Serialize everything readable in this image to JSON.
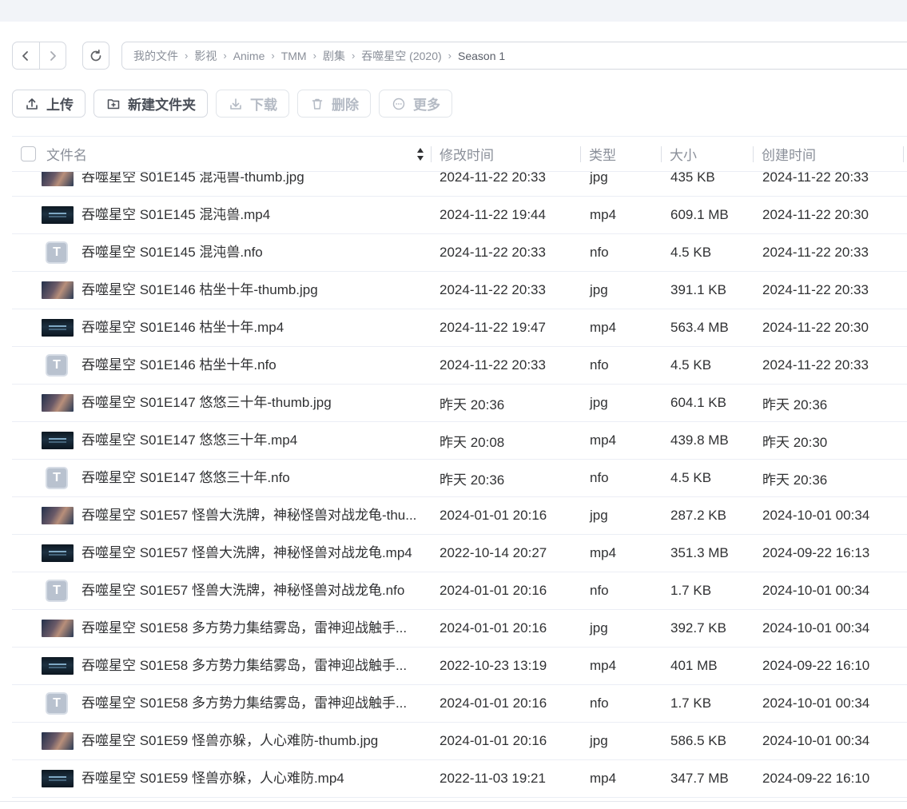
{
  "nav": {
    "breadcrumb": [
      "我的文件",
      "影视",
      "Anime",
      "TMM",
      "剧集",
      "吞噬星空 (2020)",
      "Season 1"
    ],
    "separator": "›"
  },
  "toolbar": {
    "upload": "上传",
    "new_folder": "新建文件夹",
    "download": "下载",
    "delete": "删除",
    "more": "更多"
  },
  "table": {
    "headers": {
      "name": "文件名",
      "mtime": "修改时间",
      "type": "类型",
      "size": "大小",
      "ctime": "创建时间"
    },
    "rows": [
      {
        "name": "吞噬星空 S01E145 混沌兽-thumb.jpg",
        "mtime": "2024-11-22 20:33",
        "type": "jpg",
        "size": "435 KB",
        "ctime": "2024-11-22 20:33",
        "icon": "image"
      },
      {
        "name": "吞噬星空 S01E145 混沌兽.mp4",
        "mtime": "2024-11-22 19:44",
        "type": "mp4",
        "size": "609.1 MB",
        "ctime": "2024-11-22 20:30",
        "icon": "video"
      },
      {
        "name": "吞噬星空 S01E145 混沌兽.nfo",
        "mtime": "2024-11-22 20:33",
        "type": "nfo",
        "size": "4.5 KB",
        "ctime": "2024-11-22 20:33",
        "icon": "nfo"
      },
      {
        "name": "吞噬星空 S01E146 枯坐十年-thumb.jpg",
        "mtime": "2024-11-22 20:33",
        "type": "jpg",
        "size": "391.1 KB",
        "ctime": "2024-11-22 20:33",
        "icon": "image"
      },
      {
        "name": "吞噬星空 S01E146 枯坐十年.mp4",
        "mtime": "2024-11-22 19:47",
        "type": "mp4",
        "size": "563.4 MB",
        "ctime": "2024-11-22 20:30",
        "icon": "video"
      },
      {
        "name": "吞噬星空 S01E146 枯坐十年.nfo",
        "mtime": "2024-11-22 20:33",
        "type": "nfo",
        "size": "4.5 KB",
        "ctime": "2024-11-22 20:33",
        "icon": "nfo"
      },
      {
        "name": "吞噬星空 S01E147 悠悠三十年-thumb.jpg",
        "mtime": "昨天 20:36",
        "type": "jpg",
        "size": "604.1 KB",
        "ctime": "昨天 20:36",
        "icon": "image"
      },
      {
        "name": "吞噬星空 S01E147 悠悠三十年.mp4",
        "mtime": "昨天 20:08",
        "type": "mp4",
        "size": "439.8 MB",
        "ctime": "昨天 20:30",
        "icon": "video"
      },
      {
        "name": "吞噬星空 S01E147 悠悠三十年.nfo",
        "mtime": "昨天 20:36",
        "type": "nfo",
        "size": "4.5 KB",
        "ctime": "昨天 20:36",
        "icon": "nfo"
      },
      {
        "name": "吞噬星空 S01E57 怪兽大洗牌，神秘怪兽对战龙龟-thu...",
        "mtime": "2024-01-01 20:16",
        "type": "jpg",
        "size": "287.2 KB",
        "ctime": "2024-10-01 00:34",
        "icon": "image"
      },
      {
        "name": "吞噬星空 S01E57 怪兽大洗牌，神秘怪兽对战龙龟.mp4",
        "mtime": "2022-10-14 20:27",
        "type": "mp4",
        "size": "351.3 MB",
        "ctime": "2024-09-22 16:13",
        "icon": "video"
      },
      {
        "name": "吞噬星空 S01E57 怪兽大洗牌，神秘怪兽对战龙龟.nfo",
        "mtime": "2024-01-01 20:16",
        "type": "nfo",
        "size": "1.7 KB",
        "ctime": "2024-10-01 00:34",
        "icon": "nfo"
      },
      {
        "name": "吞噬星空 S01E58 多方势力集结雾岛，雷神迎战触手...",
        "mtime": "2024-01-01 20:16",
        "type": "jpg",
        "size": "392.7 KB",
        "ctime": "2024-10-01 00:34",
        "icon": "image"
      },
      {
        "name": "吞噬星空 S01E58 多方势力集结雾岛，雷神迎战触手...",
        "mtime": "2022-10-23 13:19",
        "type": "mp4",
        "size": "401 MB",
        "ctime": "2024-09-22 16:10",
        "icon": "video"
      },
      {
        "name": "吞噬星空 S01E58 多方势力集结雾岛，雷神迎战触手...",
        "mtime": "2024-01-01 20:16",
        "type": "nfo",
        "size": "1.7 KB",
        "ctime": "2024-10-01 00:34",
        "icon": "nfo"
      },
      {
        "name": "吞噬星空 S01E59 怪兽亦躲，人心难防-thumb.jpg",
        "mtime": "2024-01-01 20:16",
        "type": "jpg",
        "size": "586.5 KB",
        "ctime": "2024-10-01 00:34",
        "icon": "image"
      },
      {
        "name": "吞噬星空 S01E59 怪兽亦躲，人心难防.mp4",
        "mtime": "2022-11-03 19:21",
        "type": "mp4",
        "size": "347.7 MB",
        "ctime": "2024-09-22 16:10",
        "icon": "video"
      }
    ]
  }
}
